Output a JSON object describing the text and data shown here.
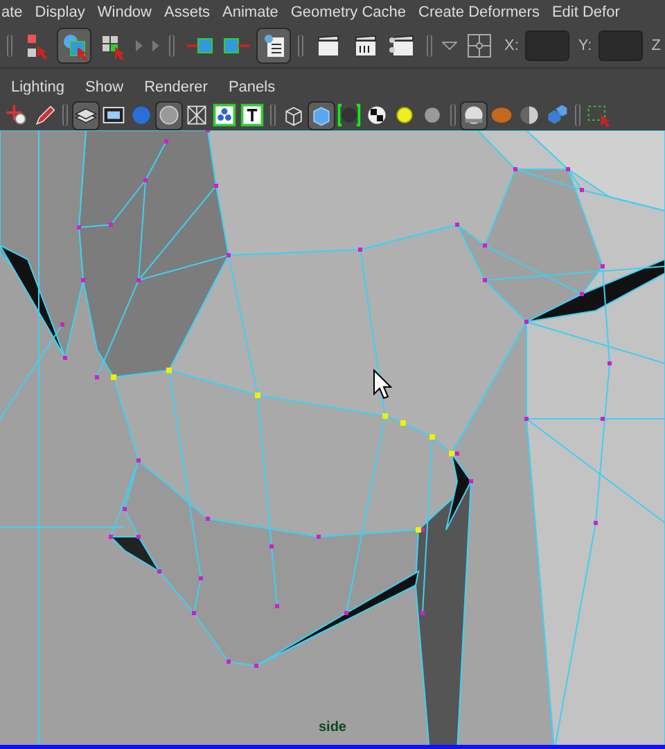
{
  "menu_bar": [
    "ate",
    "Display",
    "Window",
    "Assets",
    "Animate",
    "Geometry Cache",
    "Create Deformers",
    "Edit Defor"
  ],
  "status_line": {
    "groups": [
      [
        {
          "kind": "select-hierarchy",
          "selected": false
        },
        {
          "kind": "select-object",
          "selected": true
        },
        {
          "kind": "select-component",
          "selected": false
        },
        {
          "kind": "collapse-arrow",
          "selected": false
        },
        {
          "kind": "collapse-arrow",
          "selected": false
        }
      ],
      [
        {
          "kind": "input-ops",
          "selected": false
        },
        {
          "kind": "output-ops",
          "selected": false
        },
        {
          "kind": "render-history",
          "selected": true
        }
      ],
      [
        {
          "kind": "clapper",
          "selected": false
        },
        {
          "kind": "clapper-ipr",
          "selected": false
        },
        {
          "kind": "clapper-dots",
          "selected": false
        }
      ],
      [
        {
          "kind": "dropdown",
          "selected": false
        },
        {
          "kind": "snap-target",
          "selected": false
        }
      ]
    ],
    "fields": [
      {
        "label": "X:"
      },
      {
        "label": "Y:"
      }
    ],
    "trailing_label": "Z"
  },
  "panel_menu": [
    "Lighting",
    "Show",
    "Renderer",
    "Panels"
  ],
  "panel_toolbar": {
    "groups": [
      [
        {
          "kind": "camera-select",
          "selected": false
        },
        {
          "kind": "pencil",
          "selected": false
        }
      ],
      [
        {
          "kind": "layers",
          "selected": true
        },
        {
          "kind": "film",
          "selected": false
        },
        {
          "kind": "sphere-blue",
          "selected": false
        },
        {
          "kind": "circle",
          "selected": true
        },
        {
          "kind": "xray",
          "selected": false
        },
        {
          "kind": "points",
          "selected": false
        },
        {
          "kind": "text-t",
          "selected": false
        }
      ],
      [
        {
          "kind": "cube-wire",
          "selected": false
        },
        {
          "kind": "cube-shaded",
          "selected": true
        },
        {
          "kind": "wire-shaded",
          "selected": false
        },
        {
          "kind": "checker",
          "selected": false
        },
        {
          "kind": "light-yellow",
          "selected": false
        },
        {
          "kind": "sphere-gray",
          "selected": false
        }
      ],
      [
        {
          "kind": "sphere-white",
          "selected": true
        },
        {
          "kind": "ball-orange",
          "selected": false
        },
        {
          "kind": "half-sphere",
          "selected": false
        },
        {
          "kind": "cubes-blue",
          "selected": false
        }
      ],
      [
        {
          "kind": "dashed-select",
          "selected": false
        }
      ]
    ]
  },
  "viewport": {
    "camera_label": "side"
  }
}
